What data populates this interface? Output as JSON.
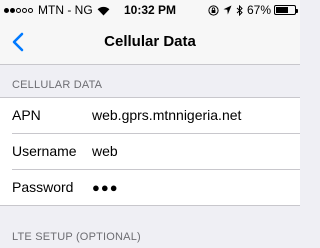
{
  "status_bar": {
    "carrier": "MTN - NG",
    "time": "10:32 PM",
    "battery_percent": "67%",
    "battery_level": 0.67,
    "signal_bars_filled": 2,
    "signal_bars_total": 5,
    "icons": [
      "wifi-icon",
      "lock-rotation-icon",
      "location-icon",
      "bluetooth-icon"
    ]
  },
  "nav": {
    "title": "Cellular Data",
    "back_icon": "chevron-left-icon",
    "accent": "#007aff"
  },
  "cellular_section": {
    "header": "CELLULAR DATA",
    "rows": [
      {
        "label": "APN",
        "value": "web.gprs.mtnnigeria.net"
      },
      {
        "label": "Username",
        "value": "web"
      },
      {
        "label": "Password",
        "value": "●●●"
      }
    ]
  },
  "lte_section": {
    "header": "LTE SETUP (OPTIONAL)"
  }
}
